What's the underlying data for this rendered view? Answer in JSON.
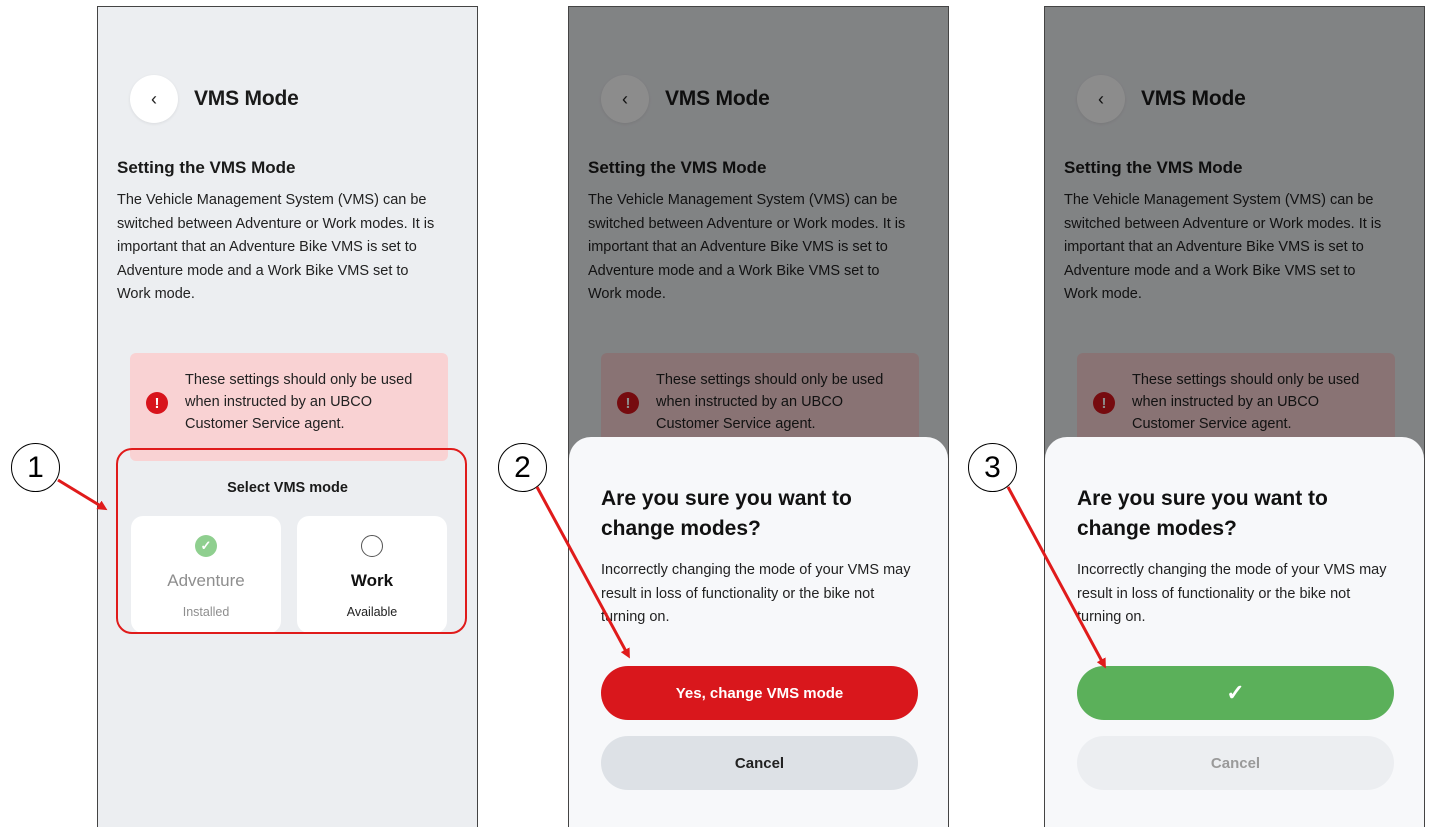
{
  "screen": {
    "title": "VMS Mode",
    "section_title": "Setting the VMS Mode",
    "description": "The Vehicle Management System (VMS) can be switched between Adventure or Work modes. It is important that an Adventure Bike VMS is set to Adventure mode and a Work Bike VMS set to Work mode.",
    "warning": "These settings should only be used when instructed by an UBCO Customer Service agent."
  },
  "selector": {
    "label": "Select VMS mode",
    "options": [
      {
        "name": "Adventure",
        "status": "Installed",
        "selected": true
      },
      {
        "name": "Work",
        "status": "Available",
        "selected": false
      }
    ]
  },
  "dialog": {
    "title": "Are you sure you want to change modes?",
    "body": "Incorrectly changing the mode of your VMS may result in loss of functionality or the bike not turning on.",
    "confirm_label": "Yes, change VMS mode",
    "cancel_label": "Cancel"
  },
  "steps": [
    "1",
    "2",
    "3"
  ],
  "icons": {
    "back": "chevron-left-icon",
    "warning": "exclamation-circle-icon",
    "selected": "check-circle-icon",
    "unselected": "radio-empty-icon",
    "success": "checkmark-icon"
  },
  "colors": {
    "danger": "#d9171c",
    "success": "#5bb05a",
    "annotation": "#e01b1b",
    "warning_bg": "#f9d2d3",
    "screen_bg": "#eceef1"
  }
}
